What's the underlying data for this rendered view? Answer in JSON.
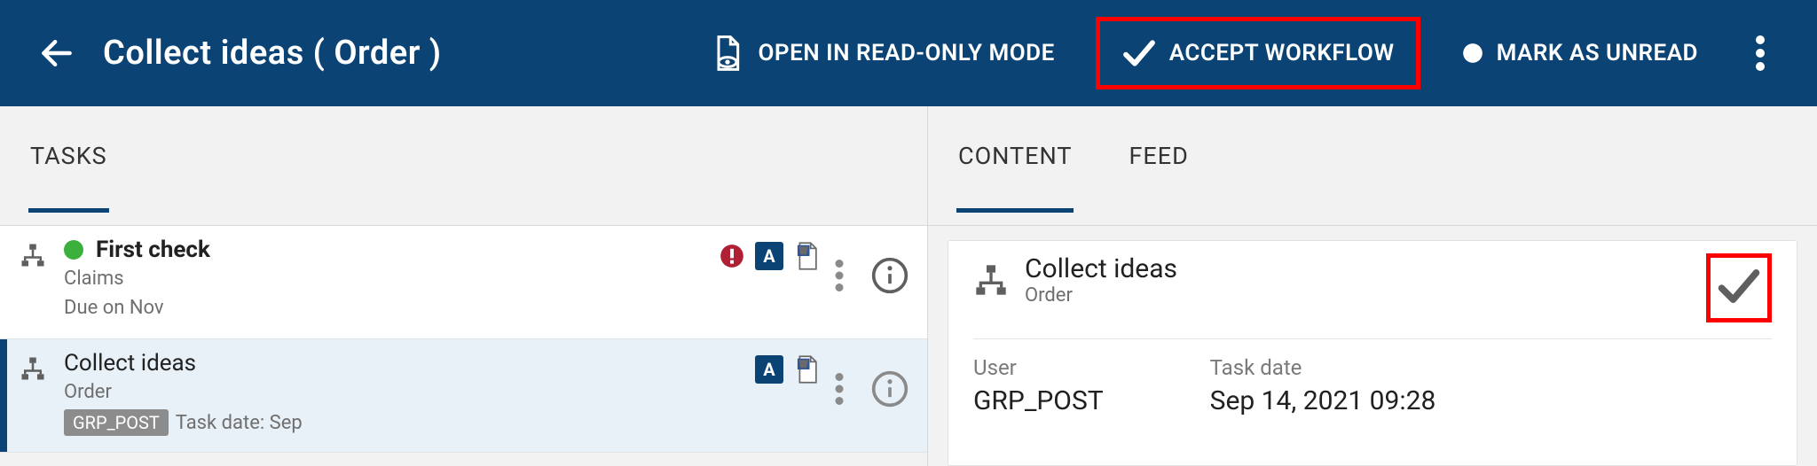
{
  "header": {
    "title": "Collect ideas ( Order )",
    "actions": {
      "open_read_only": "OPEN IN READ-ONLY MODE",
      "accept_workflow": "ACCEPT WORKFLOW",
      "mark_unread": "MARK AS UNREAD"
    }
  },
  "left": {
    "tabs": {
      "tasks": "TASKS"
    },
    "tasks": [
      {
        "title": "First check",
        "bold": true,
        "status_color": "#3cb03c",
        "line2": "Claims",
        "line3": "Due on Nov",
        "has_alert": true,
        "type_badge": "A"
      },
      {
        "title": "Collect ideas",
        "bold": false,
        "line2": "Order",
        "chip": "GRP_POST",
        "line3_after_chip": "Task date: Sep",
        "type_badge": "A",
        "selected": true
      }
    ]
  },
  "right": {
    "tabs": {
      "content": "CONTENT",
      "feed": "FEED"
    },
    "card": {
      "title": "Collect ideas",
      "subtitle": "Order",
      "fields": {
        "user": {
          "label": "User",
          "value": "GRP_POST"
        },
        "task_date": {
          "label": "Task date",
          "value": "Sep 14, 2021 09:28"
        }
      }
    }
  }
}
